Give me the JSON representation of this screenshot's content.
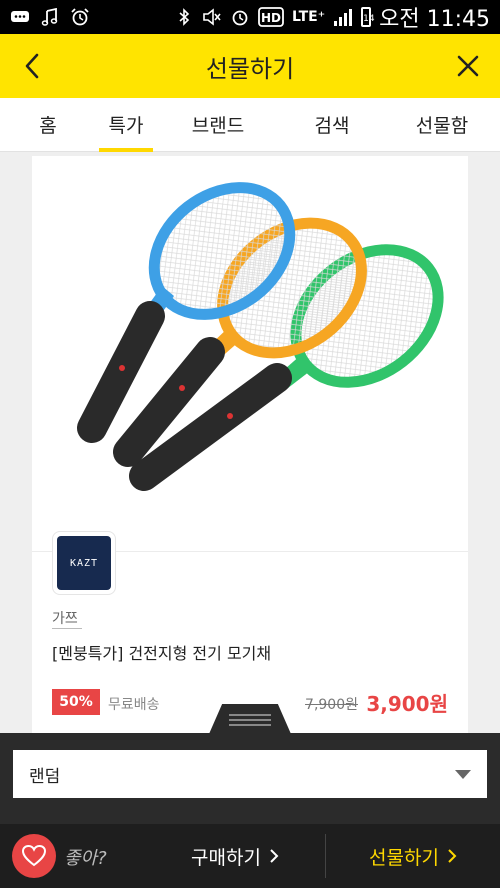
{
  "statusbar": {
    "lte": "LTE⁺",
    "battery_level": "14",
    "time": "오전 11:45",
    "icons": [
      "chat-icon",
      "music-icon",
      "alarm-icon",
      "bluetooth-icon",
      "mute-icon",
      "alarm-icon",
      "hd-icon",
      "signal-icon"
    ]
  },
  "header": {
    "title": "선물하기",
    "back_icon": "chevron-left-icon",
    "close_icon": "close-icon"
  },
  "tabs": [
    {
      "label": "홈",
      "active": false
    },
    {
      "label": "특가",
      "active": true
    },
    {
      "label": "브랜드",
      "active": false
    },
    {
      "label": "검색",
      "active": false
    },
    {
      "label": "선물함",
      "active": false
    }
  ],
  "product": {
    "brand_logo_text": "KAZT",
    "seller": "가쯔",
    "name": "[멘붕특가] 건전지형 전기 모기채",
    "discount": "50%",
    "shipping": "무료배송",
    "original_price": "7,900원",
    "sale_price": "3,900원",
    "racket_colors": [
      "#3ea0e6",
      "#f6a623",
      "#31c46b"
    ]
  },
  "options": {
    "selected": "랜덤"
  },
  "actions": {
    "like_label": "좋아?",
    "buy_label": "구매하기",
    "gift_label": "선물하기",
    "accent": "#ffd800",
    "like_color": "#e84545"
  }
}
